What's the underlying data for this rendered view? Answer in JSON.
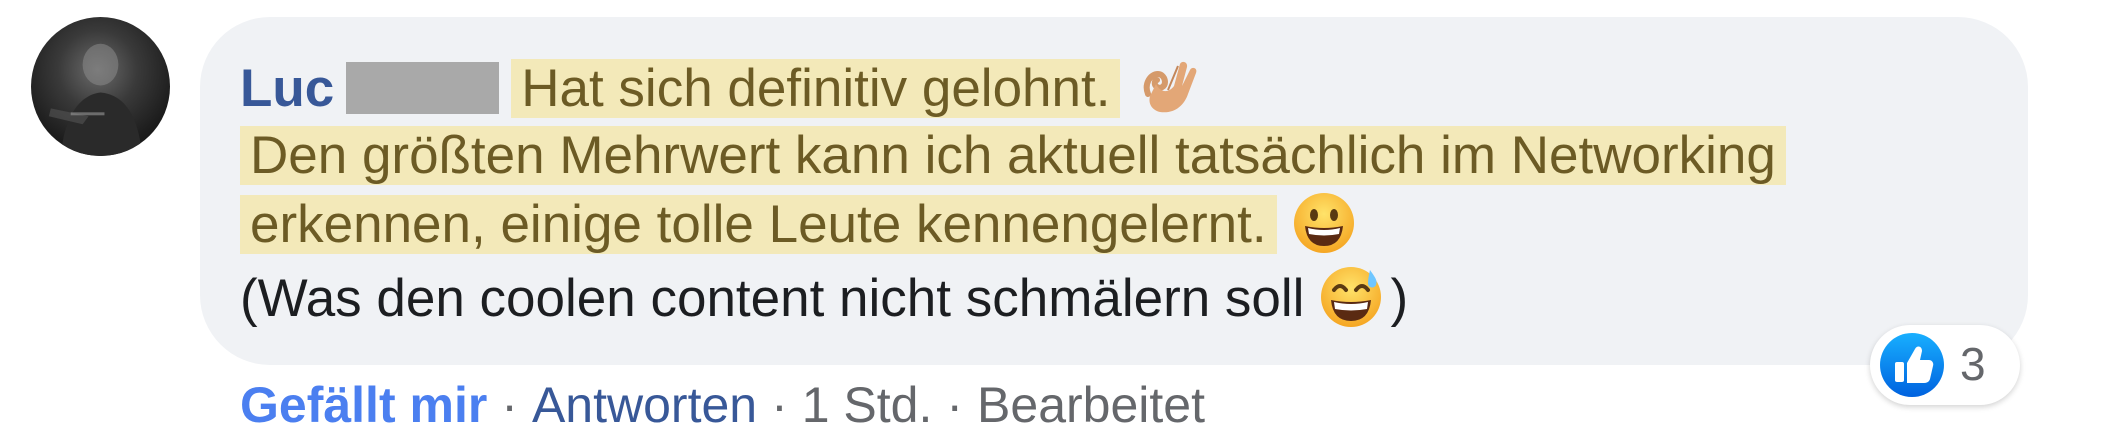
{
  "comment": {
    "author_name": "Luc",
    "line1_text": "Hat sich definitiv gelohnt.",
    "line2_text": "Den größten Mehrwert kann ich aktuell tatsächlich im Networking",
    "line3_text": "erkennen, einige tolle Leute kennengelernt.",
    "line4_text": "(Was den coolen content nicht schmälern soll",
    "line4_close": ")",
    "emojis": [
      "ok-hand-emoji",
      "grinning-face-emoji",
      "grinning-sweat-emoji"
    ],
    "highlight_color": "#f3e9b9"
  },
  "reactions": {
    "type": "like",
    "count": "3",
    "badge_color": "#1877f2"
  },
  "actions": {
    "like_label": "Gefällt mir",
    "separator": "·",
    "reply_label": "Antworten",
    "time": "1 Std.",
    "edited_label": "Bearbeitet"
  }
}
